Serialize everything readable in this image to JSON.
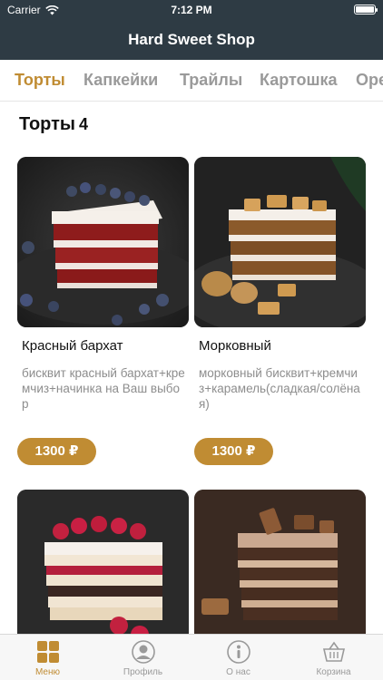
{
  "status_bar": {
    "carrier": "Carrier",
    "time": "7:12 PM"
  },
  "nav": {
    "title": "Hard Sweet Shop"
  },
  "tabs": [
    {
      "label": "Торты",
      "active": true
    },
    {
      "label": "Капкейки",
      "active": false
    },
    {
      "label": "Трайлы",
      "active": false
    },
    {
      "label": "Картошка",
      "active": false
    },
    {
      "label": "Оре",
      "active": false
    }
  ],
  "section": {
    "title": "Торты",
    "count": "4"
  },
  "products": [
    {
      "name": "Красный бархат",
      "description": "бисквит красный бархат+кремчиз+начинка на Ваш выбор",
      "price": "1300 ₽"
    },
    {
      "name": "Морковный",
      "description": "морковный бисквит+кремчиз+карамель(сладкая/солёная)",
      "price": "1300 ₽"
    },
    {
      "name": "",
      "description": "",
      "price": ""
    },
    {
      "name": "",
      "description": "",
      "price": ""
    }
  ],
  "tabbar": [
    {
      "label": "Меню",
      "icon": "menu-grid-icon",
      "active": true
    },
    {
      "label": "Профиль",
      "icon": "profile-icon",
      "active": false
    },
    {
      "label": "О нас",
      "icon": "info-icon",
      "active": false
    },
    {
      "label": "Корзина",
      "icon": "basket-icon",
      "active": false
    }
  ],
  "colors": {
    "header_bg": "#2e3b44",
    "accent": "#c08c33",
    "inactive_text": "#9a9a9a"
  }
}
